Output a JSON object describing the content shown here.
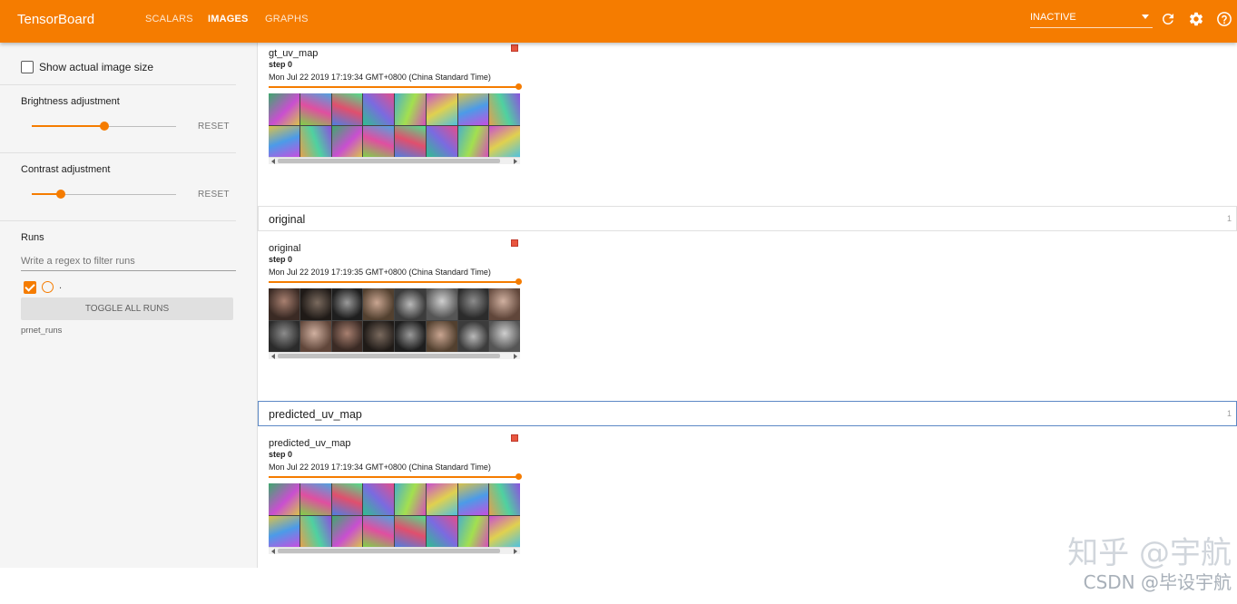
{
  "toolbar": {
    "brand": "TensorBoard",
    "tabs": [
      {
        "label": "SCALARS",
        "active": false
      },
      {
        "label": "IMAGES",
        "active": true
      },
      {
        "label": "GRAPHS",
        "active": false
      }
    ],
    "run_select_value": "INACTIVE",
    "icons": [
      "refresh-icon",
      "settings-gear-icon",
      "help-icon"
    ],
    "accent": "#f57c00"
  },
  "sidebar": {
    "show_actual_size_label": "Show actual image size",
    "brightness": {
      "label": "Brightness adjustment",
      "reset": "RESET",
      "level": 0.5
    },
    "contrast": {
      "label": "Contrast adjustment",
      "reset": "RESET",
      "level": 0.2
    },
    "runs": {
      "title": "Runs",
      "filter_placeholder": "Write a regex to filter runs",
      "run_item_label": ".",
      "toggle_all": "TOGGLE ALL RUNS",
      "run_dir": "prnet_runs"
    }
  },
  "main": {
    "categories": [
      {
        "title": "",
        "count": "",
        "card": {
          "title": "gt_uv_map",
          "step_label": "step",
          "step": "0",
          "timestamp": "Mon Jul 22 2019 17:19:34 GMT+0800 (China Standard Time)",
          "kind": "uv"
        }
      },
      {
        "title": "original",
        "count": "1",
        "card": {
          "title": "original",
          "step_label": "step",
          "step": "0",
          "timestamp": "Mon Jul 22 2019 17:19:35 GMT+0800 (China Standard Time)",
          "kind": "faces"
        }
      },
      {
        "title": "predicted_uv_map",
        "count": "1",
        "card": {
          "title": "predicted_uv_map",
          "step_label": "step",
          "step": "0",
          "timestamp": "Mon Jul 22 2019 17:19:34 GMT+0800 (China Standard Time)",
          "kind": "uv"
        }
      }
    ]
  },
  "watermark": {
    "line1": "知乎 @宇航",
    "line2": "CSDN @毕设宇航"
  }
}
